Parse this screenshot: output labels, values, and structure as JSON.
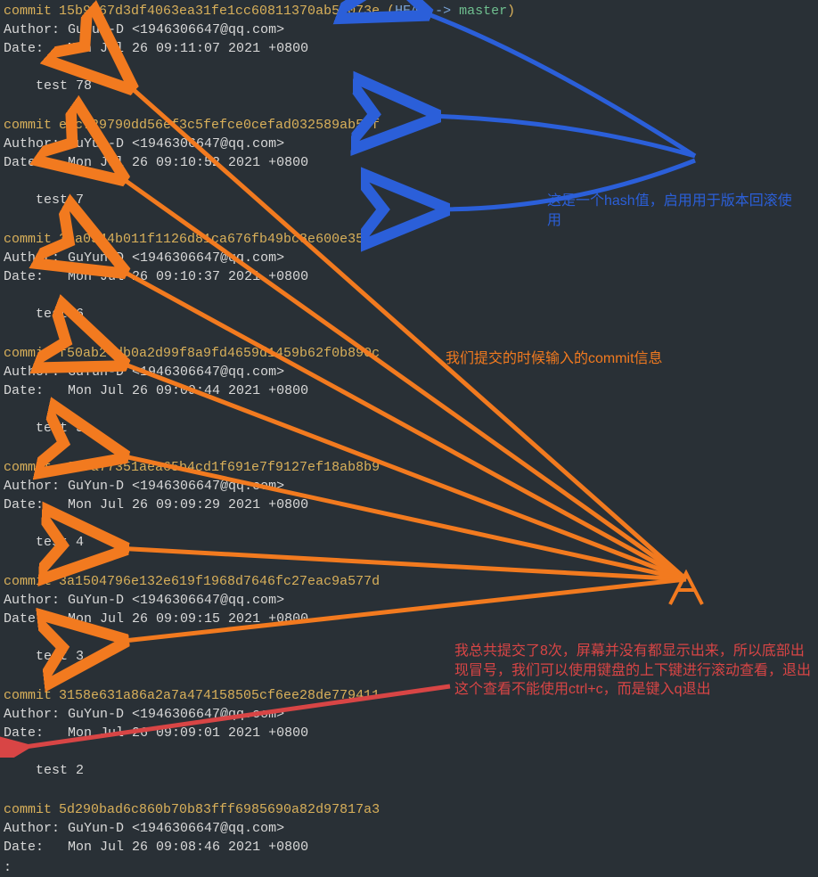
{
  "commits": [
    {
      "hash": "15b9067d3df4063ea31fe1cc60811370ab5e073e",
      "head": true,
      "authorLabel": "Author:",
      "author": "GuYun-D <1946306647@qq.com>",
      "dateLabel": "Date:",
      "date": "Mon Jul 26 09:11:07 2021 +0800",
      "message": "test 78"
    },
    {
      "hash": "efcf29790dd56ef3c5fefce0cefad032589ab50f",
      "head": false,
      "authorLabel": "Author:",
      "author": "GuYun-D <1946306647@qq.com>",
      "dateLabel": "Date:",
      "date": "Mon Jul 26 09:10:52 2021 +0800",
      "message": "test 7"
    },
    {
      "hash": "3ba0544b011f1126d81ca676fb49bc8e600e355c",
      "head": false,
      "authorLabel": "Author:",
      "author": "GuYun-D <1946306647@qq.com>",
      "dateLabel": "Date:",
      "date": "Mon Jul 26 09:10:37 2021 +0800",
      "message": "test 6"
    },
    {
      "hash": "f50ab24db0a2d99f8a9fd4659d1459b62f0b890c",
      "head": false,
      "authorLabel": "Author:",
      "author": "GuYun-D <1946306647@qq.com>",
      "dateLabel": "Date:",
      "date": "Mon Jul 26 09:09:44 2021 +0800",
      "message": "test 5"
    },
    {
      "hash": "a9e7a77351aea65b4cd1f691e7f9127ef18ab8b9",
      "head": false,
      "authorLabel": "Author:",
      "author": "GuYun-D <1946306647@qq.com>",
      "dateLabel": "Date:",
      "date": "Mon Jul 26 09:09:29 2021 +0800",
      "message": "test 4"
    },
    {
      "hash": "3a1504796e132e619f1968d7646fc27eac9a577d",
      "head": false,
      "authorLabel": "Author:",
      "author": "GuYun-D <1946306647@qq.com>",
      "dateLabel": "Date:",
      "date": "Mon Jul 26 09:09:15 2021 +0800",
      "message": "test 3"
    },
    {
      "hash": "3158e631a86a2a7a474158505cf6ee28de779411",
      "head": false,
      "authorLabel": "Author:",
      "author": "GuYun-D <1946306647@qq.com>",
      "dateLabel": "Date:",
      "date": "Mon Jul 26 09:09:01 2021 +0800",
      "message": "test 2"
    },
    {
      "hash": "5d290bad6c860b70b83fff6985690a82d97817a3",
      "head": false,
      "authorLabel": "Author:",
      "author": "GuYun-D <1946306647@qq.com>",
      "dateLabel": "Date:",
      "date": "Mon Jul 26 09:08:46 2021 +0800",
      "message": ""
    }
  ],
  "commitWord": "commit",
  "headRef": {
    "open": "(",
    "head": "HEAD",
    "arrow": "->",
    "branch": "master",
    "close": ")"
  },
  "prompt": ":",
  "annotations": {
    "blue": "这是一个hash值，启用用于版本回滚使用",
    "orange": "我们提交的时候输入的commit信息",
    "red": "我总共提交了8次，屏幕并没有都显示出来，所以底部出现冒号，我们可以使用键盘的上下键进行滚动查看，退出这个查看不能使用ctrl+c，而是键入q退出"
  },
  "colors": {
    "blue": "#2b5fd9",
    "orange": "#f27a1f",
    "red": "#d84545"
  }
}
